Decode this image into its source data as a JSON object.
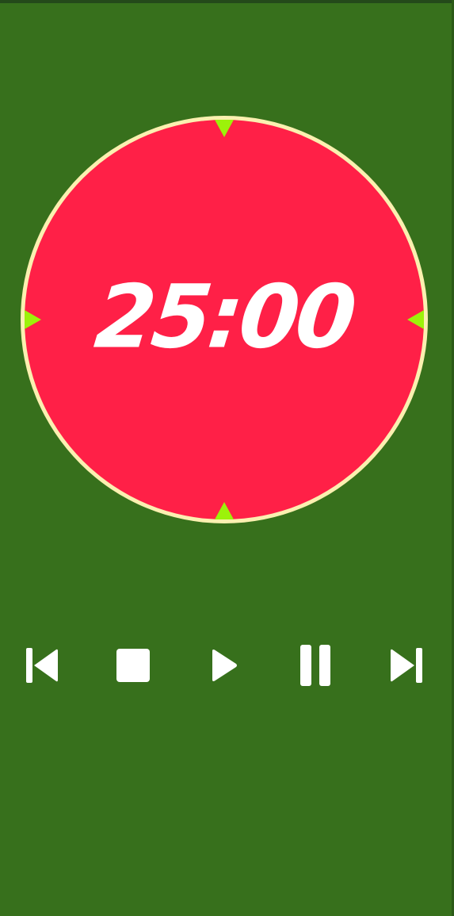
{
  "timer": {
    "time": "25:00"
  },
  "colors": {
    "background": "#37701c",
    "dial_fill": "#ff2047",
    "dial_ring": "#fbf0b0",
    "tick_markers": "#9cf20a",
    "icon_color": "#ffffff"
  },
  "controls": [
    {
      "name": "skip-previous-button",
      "icon": "skip-previous-icon"
    },
    {
      "name": "stop-button",
      "icon": "stop-icon"
    },
    {
      "name": "play-button",
      "icon": "play-icon"
    },
    {
      "name": "pause-button",
      "icon": "pause-icon"
    },
    {
      "name": "skip-next-button",
      "icon": "skip-next-icon"
    }
  ]
}
